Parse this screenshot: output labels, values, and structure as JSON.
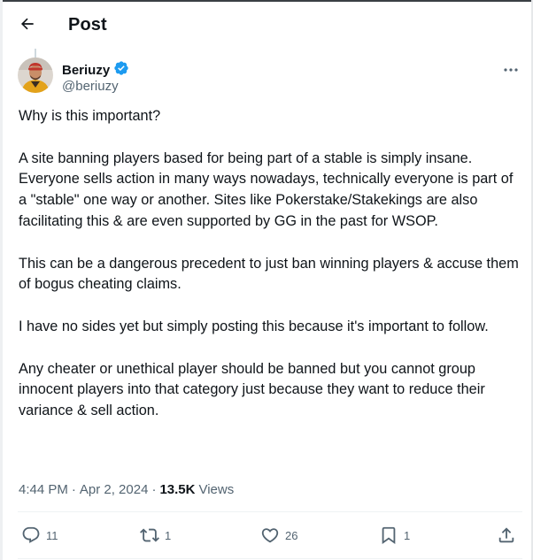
{
  "header": {
    "title": "Post"
  },
  "author": {
    "name": "Beriuzy",
    "handle": "@beriuzy"
  },
  "tweet": {
    "paragraphs": [
      "Why is this important?",
      "A site banning players based for being part of a stable is simply insane. Everyone sells action in many ways nowadays, technically everyone is part of a \"stable\" one way or another. Sites like Pokerstake/Stakekings are also facilitating this & are even supported by GG in the past for WSOP.",
      "This can be a dangerous precedent to just ban winning players & accuse them of bogus cheating claims.",
      "I have no sides yet but simply posting this because it's important to follow.",
      "Any cheater or unethical player should be banned but you cannot group innocent players into that category just because they want to reduce their variance & sell action."
    ]
  },
  "meta": {
    "time": "4:44 PM",
    "date": "Apr 2, 2024",
    "separator": "·",
    "views_count": "13.5K",
    "views_label": "Views"
  },
  "actions": {
    "replies": "11",
    "reposts": "1",
    "likes": "26",
    "bookmarks": "1"
  },
  "icons": {
    "back": "arrow-left-icon",
    "verified": "verified-badge-icon",
    "more": "more-horizontal-icon",
    "reply": "reply-icon",
    "repost": "repost-icon",
    "like": "heart-icon",
    "bookmark": "bookmark-icon",
    "share": "share-icon"
  },
  "colors": {
    "text": "#0f1419",
    "secondary": "#536471",
    "verified": "#1d9bf0",
    "divider": "#eff3f4"
  }
}
